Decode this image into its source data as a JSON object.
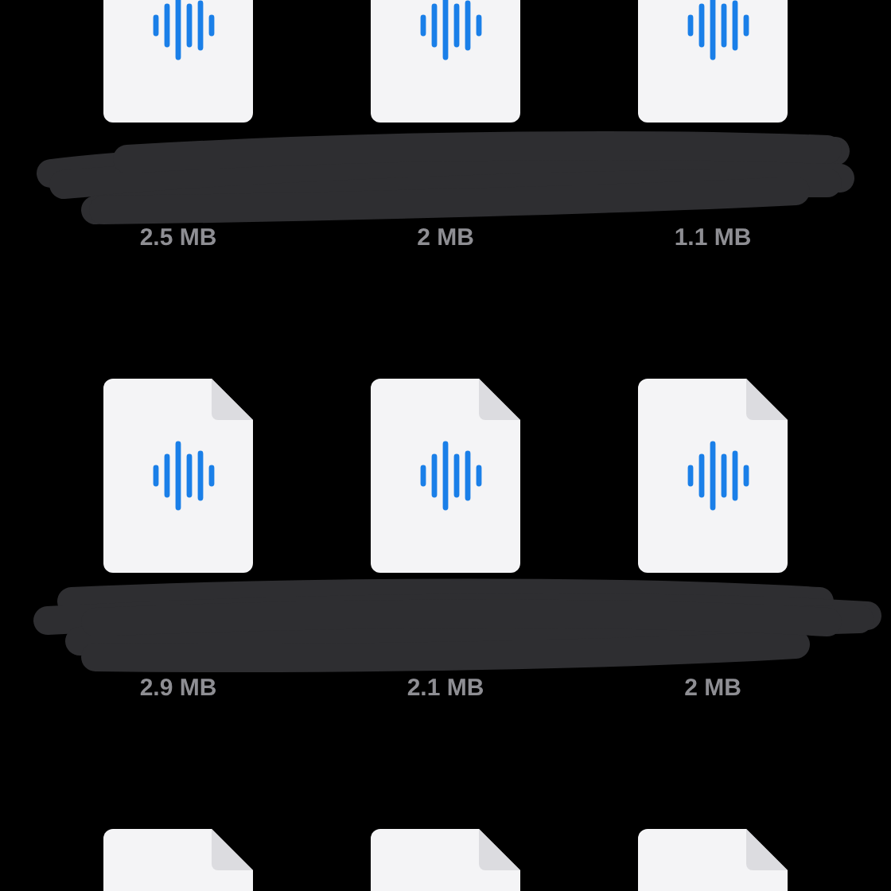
{
  "rows": [
    {
      "redacted": true,
      "files": [
        {
          "kind": "audio",
          "size": "2.5 MB"
        },
        {
          "kind": "audio",
          "size": "2 MB"
        },
        {
          "kind": "audio",
          "size": "1.1 MB"
        }
      ]
    },
    {
      "redacted": true,
      "files": [
        {
          "kind": "audio",
          "size": "2.9 MB"
        },
        {
          "kind": "audio",
          "size": "2.1 MB"
        },
        {
          "kind": "audio",
          "size": "2 MB"
        }
      ]
    },
    {
      "redacted": false,
      "files": [
        {
          "kind": "audio"
        },
        {
          "kind": "audio"
        },
        {
          "kind": "audio"
        }
      ]
    }
  ]
}
